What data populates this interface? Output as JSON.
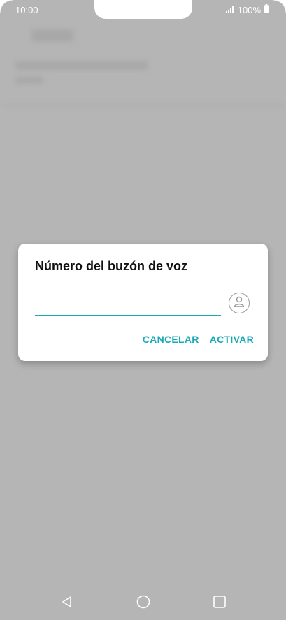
{
  "status_bar": {
    "time": "10:00",
    "battery_text": "100%",
    "icons": [
      "signal-icon",
      "battery-icon"
    ]
  },
  "dialog": {
    "title": "Número del buzón de voz",
    "input": {
      "value": "",
      "placeholder": ""
    },
    "contact_icon": "contact-picker-icon",
    "cancel_label": "CANCELAR",
    "activate_label": "ACTIVAR"
  },
  "nav_bar": {
    "icons": [
      "back-icon",
      "home-icon",
      "recents-icon"
    ]
  },
  "colors": {
    "accent": "#1aa9b6",
    "scrim": "#b5b5b5",
    "dialog_bg": "#ffffff"
  }
}
